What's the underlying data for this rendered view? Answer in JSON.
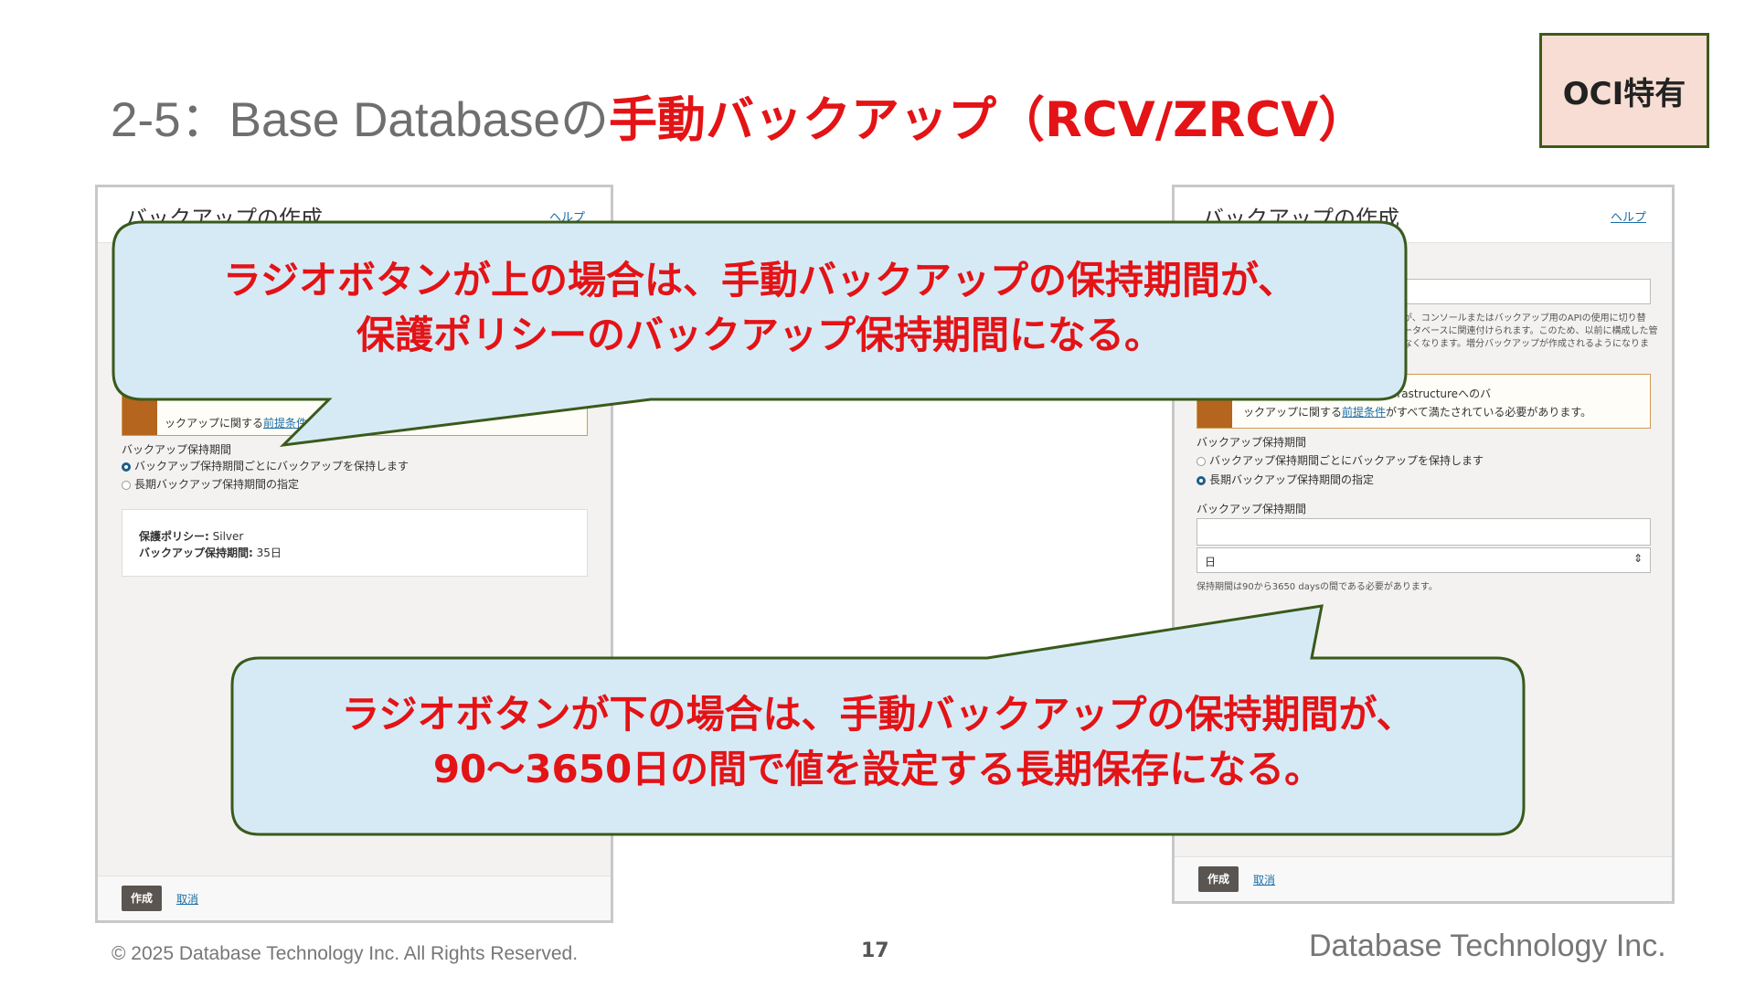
{
  "slide": {
    "title_prefix": "2-5：Base Databaseの",
    "title_highlight": "手動バックアップ（RCV/ZRCV）",
    "badge": "OCI特有",
    "page_number": "17",
    "copyright": "© 2025 Database Technology Inc. All Rights Reserved.",
    "brand": "Database Technology Inc."
  },
  "left_panel": {
    "title": "バックアップの作成",
    "help": "ヘルプ",
    "notice_text": "ックアップに関する",
    "notice_link": "前提条件",
    "retention_label": "バックアップ保持期間",
    "radio_options": [
      {
        "label": "バックアップ保持期間ごとにバックアップを保持します",
        "checked": true
      },
      {
        "label": "長期バックアップ保持期間の指定",
        "checked": false
      }
    ],
    "policy_label": "保護ポリシー:",
    "policy_value": "Silver",
    "period_label": "バックアップ保持期間:",
    "period_value": "35日",
    "create_button": "作成",
    "cancel_link": "取消"
  },
  "right_panel": {
    "title": "バックアップの作成",
    "help": "ヘルプ",
    "description_lines": [
      "が、コンソールまたはバックアップ用のAPIの使用に切り替",
      "ータベースに関連付けられます。このため、以前に構成した管",
      "なくなります。増分バックアップが作成されるようになりま"
    ],
    "notice_line1": "るためには、Oracle Cloud Infrastructureへのバ",
    "notice_line2_prefix": "ックアップに関する",
    "notice_link": "前提条件",
    "notice_line2_suffix": "がすべて満たされている必要があります。",
    "retention_label": "バックアップ保持期間",
    "radio_options": [
      {
        "label": "バックアップ保持期間ごとにバックアップを保持します",
        "checked": false
      },
      {
        "label": "長期バックアップ保持期間の指定",
        "checked": true
      }
    ],
    "period_field_label": "バックアップ保持期間",
    "period_unit_value": "日",
    "hint": "保持期間は90から3650 daysの間である必要があります。",
    "create_button": "作成",
    "cancel_link": "取消"
  },
  "callouts": {
    "top": {
      "line1": "ラジオボタンが上の場合は、手動バックアップの保持期間が、",
      "line2": "保護ポリシーのバックアップ保持期間になる。"
    },
    "bottom": {
      "line1": "ラジオボタンが下の場合は、手動バックアップの保持期間が、",
      "line2": "90～3650日の間で値を設定する長期保存になる。"
    }
  },
  "colors": {
    "accent_red": "#e31316",
    "callout_fill": "#d6eaf6",
    "callout_border": "#3a5a1b",
    "badge_fill": "#f7ddd3",
    "button_dark": "#5a5550",
    "link_blue": "#1a6ea8"
  }
}
